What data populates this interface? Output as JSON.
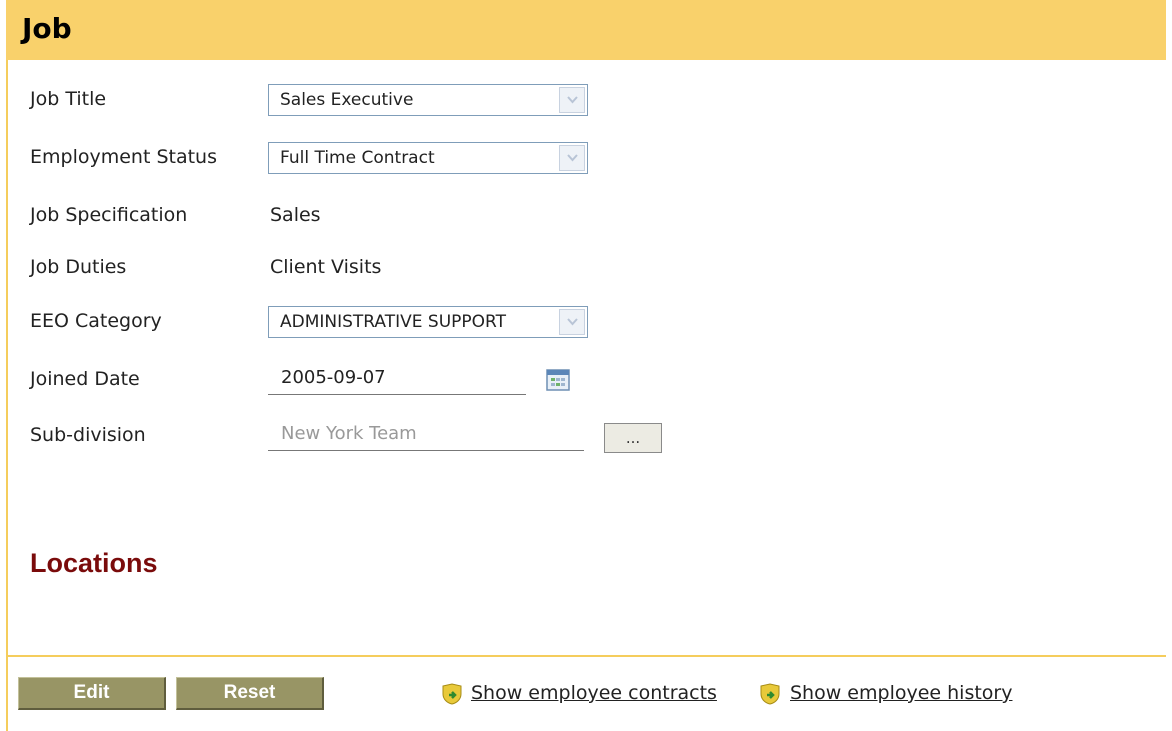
{
  "header": {
    "title": "Job"
  },
  "form": {
    "job_title": {
      "label": "Job Title",
      "value": "Sales Executive"
    },
    "employment_status": {
      "label": "Employment Status",
      "value": "Full Time Contract"
    },
    "job_specification": {
      "label": "Job Specification",
      "value": "Sales"
    },
    "job_duties": {
      "label": "Job Duties",
      "value": "Client Visits"
    },
    "eeo_category": {
      "label": "EEO Category",
      "value": "ADMINISTRATIVE SUPPORT"
    },
    "joined_date": {
      "label": "Joined Date",
      "value": "2005-09-07"
    },
    "sub_division": {
      "label": "Sub-division",
      "value": "New York Team",
      "browse_label": "..."
    }
  },
  "locations": {
    "title": "Locations"
  },
  "footer": {
    "edit_label": "Edit",
    "reset_label": "Reset",
    "contracts_link": "Show employee contracts",
    "history_link": "Show employee history"
  },
  "icons": {
    "dropdown": "chevron-down-icon",
    "calendar": "calendar-icon",
    "link": "shield-arrow-icon"
  },
  "colors": {
    "header_bg": "#f9d16b",
    "locations_title": "#7a0b0b",
    "button_bg": "#989565"
  }
}
